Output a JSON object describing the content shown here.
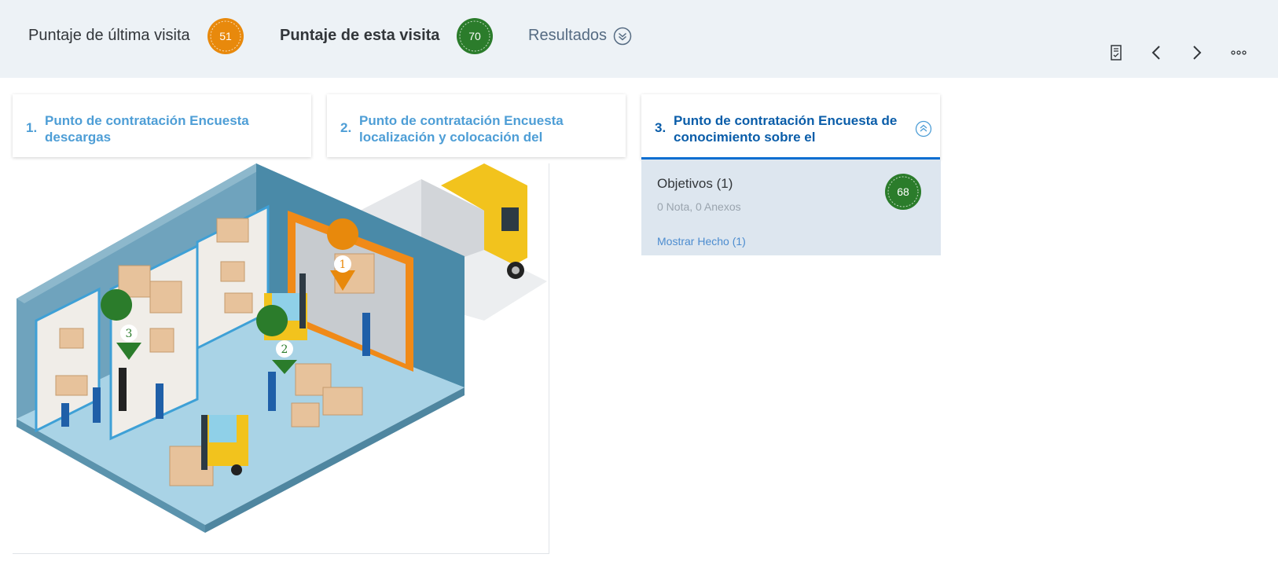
{
  "header": {
    "last_visit_label": "Puntaje de última visita",
    "last_visit_score": "51",
    "this_visit_label": "Puntaje de esta visita",
    "this_visit_score": "70",
    "results_label": "Resultados"
  },
  "colors": {
    "orange_badge": "#e8890c",
    "green_badge": "#2b7c2b",
    "link_blue": "#4e9ed6",
    "active_blue": "#0a5da9",
    "header_bg": "#edf2f6",
    "panel_bg": "#dde6ef"
  },
  "toolbar": {
    "icons": [
      "checklist-icon",
      "chevron-left-icon",
      "chevron-right-icon",
      "overflow-icon"
    ]
  },
  "cards": [
    {
      "number": "1.",
      "title": "Punto de contratación Encuesta descargas"
    },
    {
      "number": "2.",
      "title": "Punto de contratación Encuesta localización y colocación del"
    },
    {
      "number": "3.",
      "title": "Punto de contratación Encuesta de conocimiento sobre el"
    }
  ],
  "panel": {
    "objectives": "Objetivos (1)",
    "notes": "0 Nota, 0 Anexos",
    "score": "68",
    "link": "Mostrar Hecho (1)"
  },
  "map_pins": [
    {
      "label": "1"
    },
    {
      "label": "2"
    },
    {
      "label": "3"
    }
  ]
}
